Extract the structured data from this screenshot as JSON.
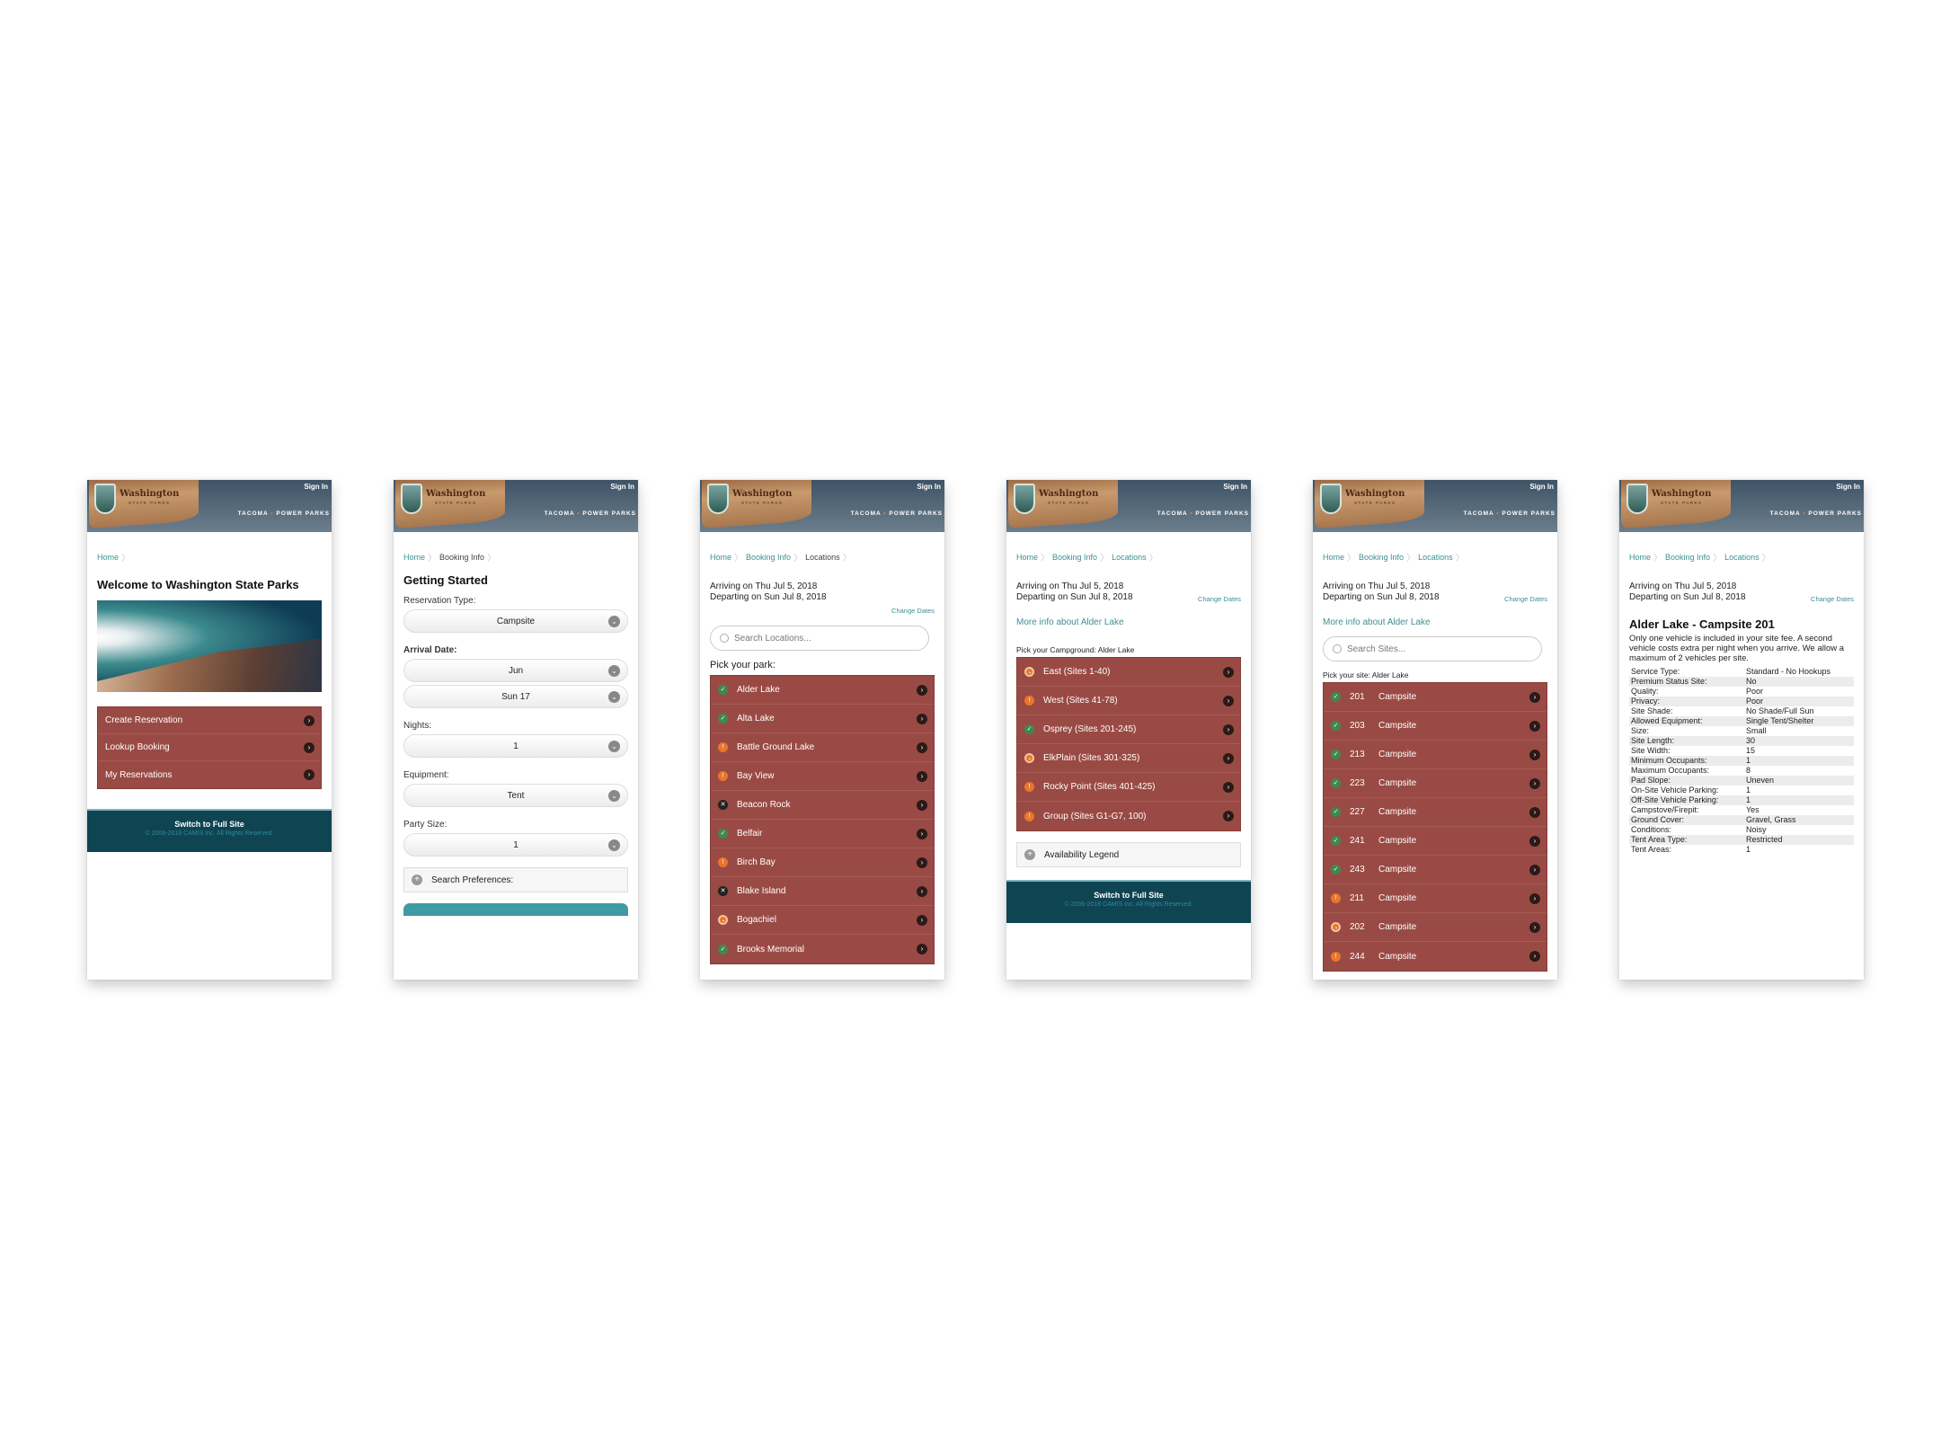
{
  "header": {
    "brand_title": "Washington",
    "brand_subtitle": "STATE PARKS",
    "partner": "TACOMA",
    "partner_sep": "•",
    "partner_tail": "POWER PARKS",
    "sign_in": "Sign In"
  },
  "footer": {
    "switch_label": "Switch to Full Site",
    "copyright": "© 2006-2018 CAMIS Inc. All Rights Reserved."
  },
  "colors": {
    "menu_bg": "#9a4a44",
    "footer_bg": "#0f4452",
    "link": "#3e8f93",
    "status_available": "#3e8a4d",
    "status_partial": "#e8762d"
  },
  "screen1": {
    "breadcrumb": [
      "Home"
    ],
    "title": "Welcome to Washington State Parks",
    "menu": [
      "Create Reservation",
      "Lookup Booking",
      "My Reservations"
    ]
  },
  "screen2": {
    "breadcrumb": [
      "Home",
      "Booking Info"
    ],
    "title": "Getting Started",
    "reservation_type_label": "Reservation Type:",
    "reservation_type": "Campsite",
    "arrival_label": "Arrival Date:",
    "arrival_month": "Jun",
    "arrival_day": "Sun 17",
    "nights_label": "Nights:",
    "nights": "1",
    "equipment_label": "Equipment:",
    "equipment": "Tent",
    "party_label": "Party Size:",
    "party": "1",
    "search_prefs": "Search Preferences:"
  },
  "dates": {
    "arriving": "Arriving on Thu Jul 5, 2018",
    "departing": "Departing on Sun Jul 8, 2018",
    "change": "Change Dates"
  },
  "screen3": {
    "breadcrumb": [
      "Home",
      "Booking Info",
      "Locations"
    ],
    "search_placeholder": "Search Locations...",
    "pick_label": "Pick your park:",
    "parks": [
      {
        "name": "Alder Lake",
        "status": "available"
      },
      {
        "name": "Alta Lake",
        "status": "available"
      },
      {
        "name": "Battle Ground Lake",
        "status": "partial"
      },
      {
        "name": "Bay View",
        "status": "partial"
      },
      {
        "name": "Beacon Rock",
        "status": "closed"
      },
      {
        "name": "Belfair",
        "status": "available"
      },
      {
        "name": "Birch Bay",
        "status": "partial"
      },
      {
        "name": "Blake Island",
        "status": "closed"
      },
      {
        "name": "Bogachiel",
        "status": "mixed"
      },
      {
        "name": "Brooks Memorial",
        "status": "available"
      }
    ]
  },
  "screen4": {
    "breadcrumb": [
      "Home",
      "Booking Info",
      "Locations"
    ],
    "more_info": "More info about Alder Lake",
    "pick_label": "Pick your Campground: Alder Lake",
    "campgrounds": [
      {
        "name": "East (Sites 1-40)",
        "status": "mixed"
      },
      {
        "name": "West (Sites 41-78)",
        "status": "partial"
      },
      {
        "name": "Osprey (Sites 201-245)",
        "status": "available"
      },
      {
        "name": "ElkPlain (Sites 301-325)",
        "status": "mixed"
      },
      {
        "name": "Rocky Point (Sites 401-425)",
        "status": "partial"
      },
      {
        "name": "Group (Sites G1-G7, 100)",
        "status": "partial"
      }
    ],
    "legend": "Availability Legend"
  },
  "screen5": {
    "breadcrumb": [
      "Home",
      "Booking Info",
      "Locations"
    ],
    "more_info": "More info about Alder Lake",
    "search_placeholder": "Search Sites...",
    "pick_label": "Pick your site: Alder Lake",
    "sites": [
      {
        "num": "201",
        "type": "Campsite",
        "status": "available"
      },
      {
        "num": "203",
        "type": "Campsite",
        "status": "available"
      },
      {
        "num": "213",
        "type": "Campsite",
        "status": "available"
      },
      {
        "num": "223",
        "type": "Campsite",
        "status": "available"
      },
      {
        "num": "227",
        "type": "Campsite",
        "status": "available"
      },
      {
        "num": "241",
        "type": "Campsite",
        "status": "available"
      },
      {
        "num": "243",
        "type": "Campsite",
        "status": "available"
      },
      {
        "num": "211",
        "type": "Campsite",
        "status": "partial"
      },
      {
        "num": "202",
        "type": "Campsite",
        "status": "mixed"
      },
      {
        "num": "244",
        "type": "Campsite",
        "status": "partial"
      }
    ]
  },
  "screen6": {
    "breadcrumb": [
      "Home",
      "Booking Info",
      "Locations"
    ],
    "title": "Alder Lake - Campsite 201",
    "note": "Only one vehicle is included in your site fee. A second vehicle costs extra per night when you arrive. We allow a maximum of 2 vehicles per site.",
    "details": [
      [
        "Service Type:",
        "Standard - No Hookups"
      ],
      [
        "Premium Status Site:",
        "No"
      ],
      [
        "Quality:",
        "Poor"
      ],
      [
        "Privacy:",
        "Poor"
      ],
      [
        "Site Shade:",
        "No Shade/Full Sun"
      ],
      [
        "Allowed Equipment:",
        "Single Tent/Shelter"
      ],
      [
        "Size:",
        "Small"
      ],
      [
        "Site Length:",
        "30"
      ],
      [
        "Site Width:",
        "15"
      ],
      [
        "Minimum Occupants:",
        "1"
      ],
      [
        "Maximum Occupants:",
        "8"
      ],
      [
        "Pad Slope:",
        "Uneven"
      ],
      [
        "On-Site Vehicle Parking:",
        "1"
      ],
      [
        "Off-Site Vehicle Parking:",
        "1"
      ],
      [
        "Campstove/Firepit:",
        "Yes"
      ],
      [
        "Ground Cover:",
        "Gravel, Grass"
      ],
      [
        "Conditions:",
        "Noisy"
      ],
      [
        "Tent Area Type:",
        "Restricted"
      ],
      [
        "Tent Areas:",
        "1"
      ]
    ]
  }
}
